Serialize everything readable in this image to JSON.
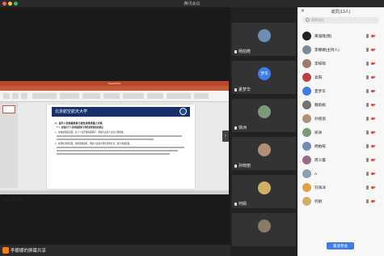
{
  "window": {
    "title": "腾讯会议"
  },
  "colors": {
    "accent": "#3f7ee8",
    "ppt_red": "#b7472a",
    "share_orange": "#ff7a00"
  },
  "presentation": {
    "app_title": "PowerPoint",
    "menu": [
      "文件",
      "开始",
      "插入",
      "设计",
      "切换",
      "动画",
      "放映",
      "审阅",
      "视图"
    ],
    "slide": {
      "institution": "北京航空航天大学",
      "heading": "2、提升人员情感质素与理性思维质量之对策",
      "subheading": "（一）加强对于人员情感质素与理性思维质量的建设",
      "paragraphs": [
        "1、在情感质素层面，对于人员开展情感辅导，重视与改善人员的心理健康。",
        "2、在理性思维层面，强化逻辑训练，帮助人员建立理性思维方式，提升决策质量。"
      ]
    },
    "status": "幻灯片 第1张，共1张"
  },
  "share": {
    "label": "李娜娜的屏幕共享",
    "icon": "screen-share-icon"
  },
  "video_tiles": [
    {
      "name": "杨柏皓",
      "avatar": "photo",
      "color": "#6a8fb5"
    },
    {
      "name": "夏梦华",
      "avatar": "text",
      "color": "#3f7ee8",
      "text": "梦华"
    },
    {
      "name": "徐洲",
      "avatar": "photo",
      "color": "#7a9a7a"
    },
    {
      "name": "孙晓丽",
      "avatar": "photo",
      "color": "#b09070"
    },
    {
      "name": "何娟",
      "avatar": "photo",
      "color": "#d0b060"
    },
    {
      "name": "",
      "avatar": "photo",
      "color": "#8a7a6a"
    }
  ],
  "panel": {
    "title": "成员(13人)",
    "search_placeholder": "搜索成员",
    "button": "邀请参会",
    "members": [
      {
        "name": "黄诚隆(我)",
        "color": "#222222",
        "control": ""
      },
      {
        "name": "李娜娜(主持人)",
        "color": "#7a8a9a",
        "control": ""
      },
      {
        "name": "李梓萌",
        "color": "#a07a6a",
        "control": ""
      },
      {
        "name": "高阳",
        "color": "#c04040",
        "control": ""
      },
      {
        "name": "夏梦华",
        "color": "#3f7ee8",
        "control": ""
      },
      {
        "name": "魏莉娟",
        "color": "#707070",
        "control": ""
      },
      {
        "name": "孙晓丽",
        "color": "#b09070",
        "control": ""
      },
      {
        "name": "徐洲",
        "color": "#7a9a7a",
        "control": ""
      },
      {
        "name": "杨柏皓",
        "color": "#6a8fb5",
        "control": ""
      },
      {
        "name": "周义露",
        "color": "#9a6a8a",
        "control": ""
      },
      {
        "name": "A",
        "color": "#8aa0b0",
        "control": ""
      },
      {
        "name": "刘海洋",
        "color": "#e0a040",
        "control": ""
      },
      {
        "name": "何娟",
        "color": "#d0b060",
        "control": ""
      }
    ]
  }
}
